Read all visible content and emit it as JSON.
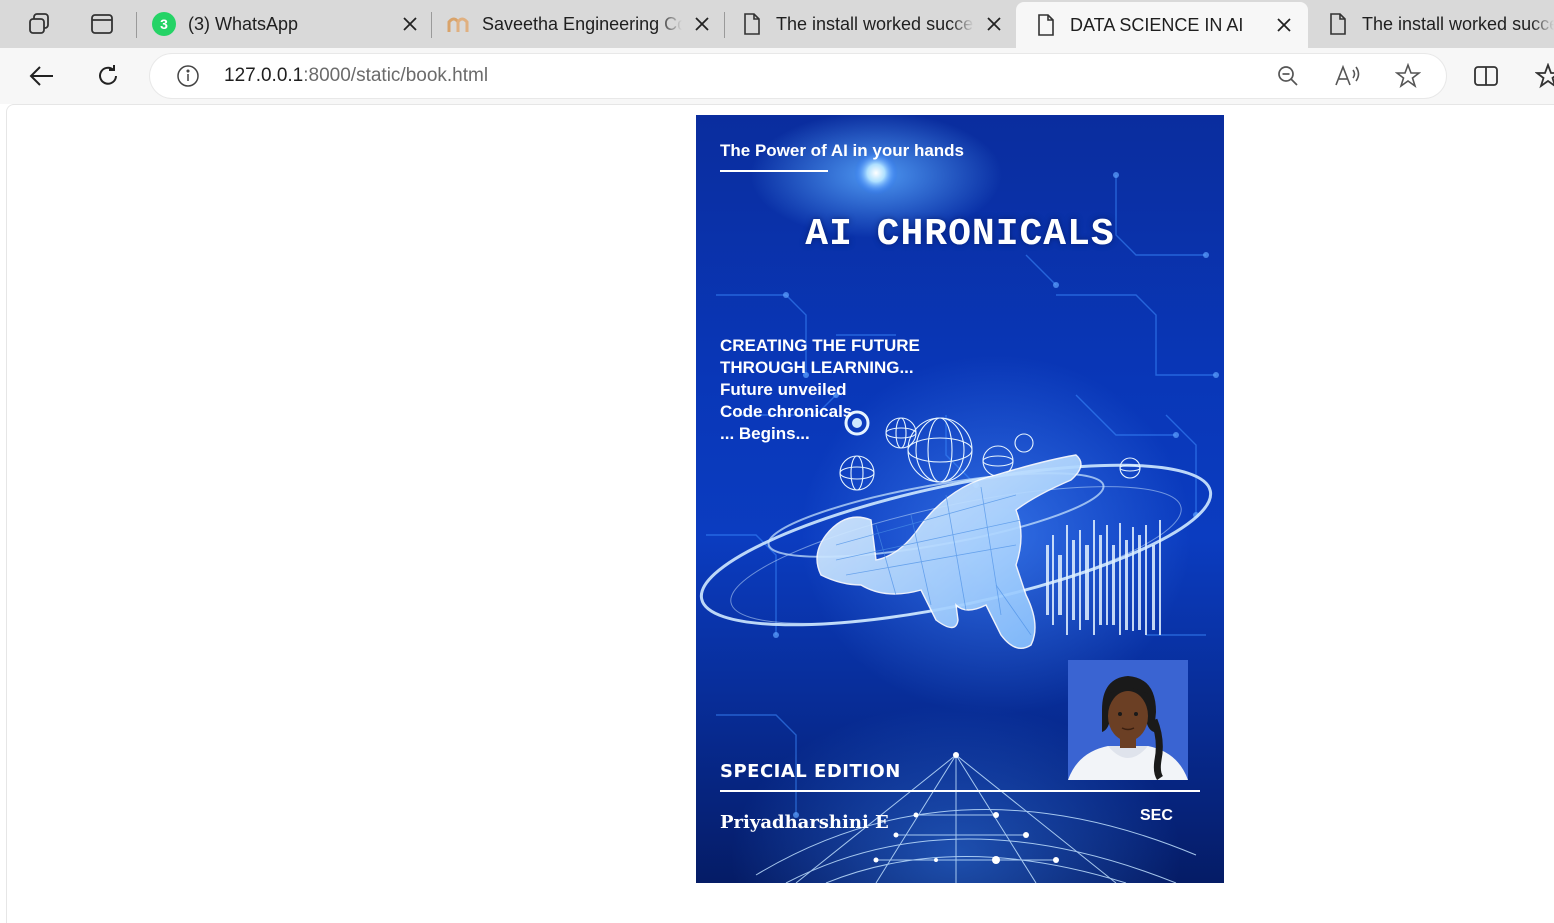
{
  "browser": {
    "tabs": [
      {
        "title": "(3) WhatsApp",
        "badge": "3",
        "favicon": "whatsapp-icon",
        "active": false
      },
      {
        "title": "Saveetha Engineering College",
        "favicon": "saveetha-icon",
        "active": false
      },
      {
        "title": "The install worked successfully",
        "favicon": "page-icon",
        "active": false
      },
      {
        "title": "DATA SCIENCE IN AI",
        "favicon": "page-icon",
        "active": true
      },
      {
        "title": "The install worked successfully",
        "favicon": "page-icon",
        "active": false
      }
    ],
    "address": {
      "host": "127.0.0.1",
      "rest": ":8000/static/book.html"
    }
  },
  "cover": {
    "tagline": "The Power of AI in your hands",
    "title": "AI CHRONICALS",
    "blurb": [
      "CREATING THE FUTURE",
      "THROUGH LEARNING...",
      "Future unveiled",
      "Code chronicals",
      "... Begins..."
    ],
    "edition": "SPECIAL EDITION",
    "author": "Priyadharshini E",
    "college": "SEC",
    "colors": {
      "cover_blue": "#0937b8",
      "glow": "#5aa8ff"
    }
  }
}
